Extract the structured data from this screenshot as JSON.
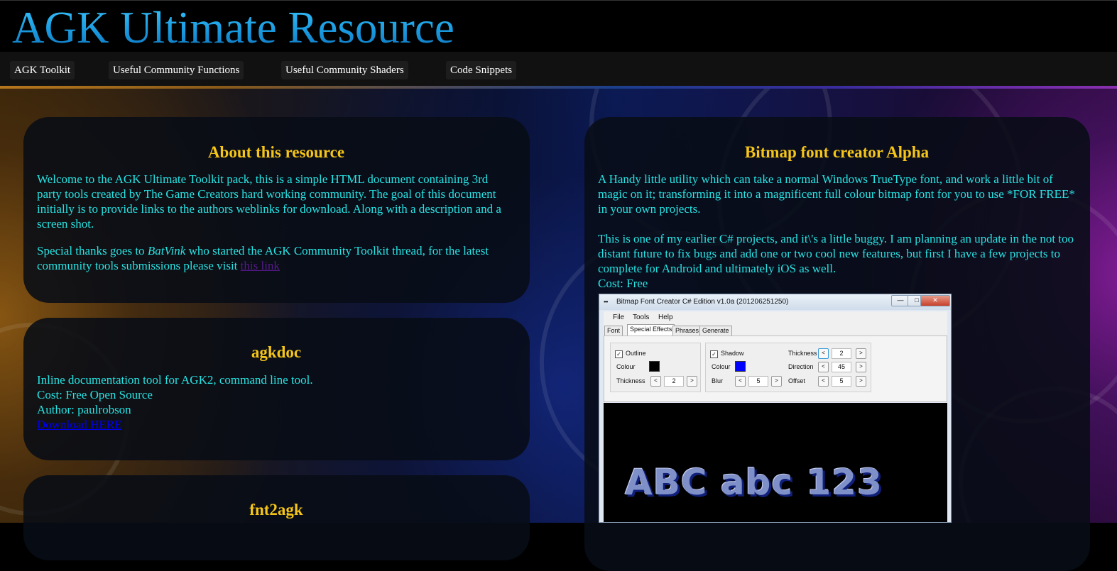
{
  "site": {
    "title": "AGK Ultimate Resource"
  },
  "nav": {
    "items": [
      {
        "label": "AGK Toolkit"
      },
      {
        "label": "Useful Community Functions"
      },
      {
        "label": "Useful Community Shaders"
      },
      {
        "label": "Code Snippets"
      }
    ]
  },
  "about": {
    "heading": "About this resource",
    "para1": "Welcome to the AGK Ultimate Toolkit pack, this is a simple HTML document containing 3rd party tools created by The Game Creators hard working community. The goal of this document initially is to provide links to the authors weblinks for download. Along with a description and a screen shot.",
    "para2_before": "Special thanks goes to ",
    "para2_name": "BatVink",
    "para2_after": " who started the AGK Community Toolkit thread, for the latest community tools submissions please visit ",
    "link": "this link"
  },
  "agkdoc": {
    "heading": "agkdoc",
    "description": "Inline documentation tool for AGK2, command line tool.",
    "cost": "Cost: Free Open Source",
    "author": "Author: paulrobson",
    "download": "Download HERE"
  },
  "fnt2agk": {
    "heading": "fnt2agk"
  },
  "bitmap": {
    "heading": "Bitmap font creator Alpha",
    "para1": "A Handy little utility which can take a normal Windows TrueType font, and work a little bit of magic on it; transforming it into a magnificent full colour bitmap font for you to use *FOR FREE* in your own projects.",
    "para2": "This is one of my earlier C# projects, and it\\'s a little buggy. I am planning an update in the not too distant future to fix bugs and add one or two cool new features, but first I have a few projects to complete for Android and ultimately iOS as well.",
    "cost": "Cost: Free"
  },
  "app": {
    "title": "Bitmap Font Creator C# Edition v1.0a (201206251250)",
    "icon_text": "•••",
    "menu": [
      "File",
      "Tools",
      "Help"
    ],
    "tabs": [
      "Font",
      "Special Effects",
      "Phrases",
      "Generate"
    ],
    "outline_label": "Outline",
    "outline_colour_label": "Colour",
    "outline_colour": "#000000",
    "outline_thickness_label": "Thickness",
    "outline_thickness": "2",
    "shadow_label": "Shadow",
    "shadow_colour_label": "Colour",
    "shadow_colour": "#0000ff",
    "blur_label": "Blur",
    "blur": "5",
    "shadow_thickness_label": "Thickness",
    "shadow_thickness": "2",
    "direction_label": "Direction",
    "direction": "45",
    "offset_label": "Offset",
    "offset": "5",
    "check_mark": "✓",
    "preview_text": "ABC abc 123",
    "win_min": "—",
    "win_max": "□",
    "win_close": "✕",
    "dec": "<",
    "inc": ">"
  }
}
